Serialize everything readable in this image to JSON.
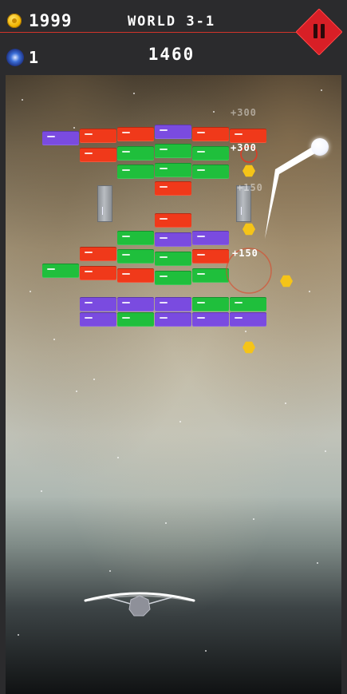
{
  "hud": {
    "coins": "1999",
    "coin_icon": "gold-coin-icon",
    "world": "WORLD 3-1",
    "orbs": "1",
    "orb_icon": "blue-orb-icon",
    "score": "1460",
    "pause_icon": "pause-icon",
    "accent_color": "#d81f26"
  },
  "popups": {
    "p1": "+300",
    "p2": "+300",
    "p3": "+150",
    "p4": "+150"
  },
  "colors": {
    "red": "#f0391a",
    "green": "#1fbf3c",
    "purple": "#7a4be0",
    "coin": "#f5c418"
  }
}
